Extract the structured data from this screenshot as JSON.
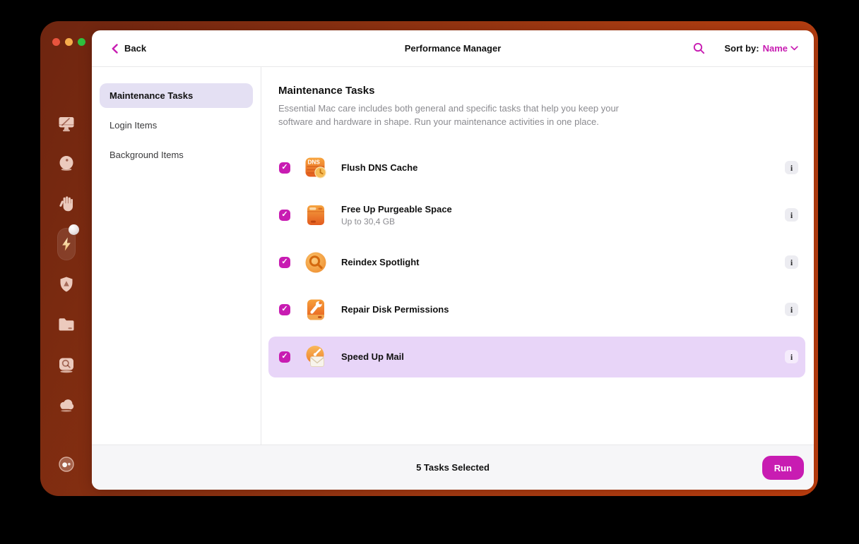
{
  "colors": {
    "accent_magenta": "#c81cb2",
    "highlight_row": "#e8d5f8",
    "selected_pill": "#e4e0f3",
    "frame_gradient_start": "#6e2510",
    "frame_gradient_end": "#c2400f",
    "traffic_red": "#e8543e",
    "traffic_yellow": "#f6ad4c",
    "traffic_green": "#2fc33f"
  },
  "header": {
    "back": "Back",
    "title": "Performance Manager",
    "sort_label": "Sort by:",
    "sort_value": "Name"
  },
  "sidebar": {
    "items": [
      {
        "label": "Maintenance Tasks",
        "selected": true
      },
      {
        "label": "Login Items",
        "selected": false
      },
      {
        "label": "Background Items",
        "selected": false
      }
    ]
  },
  "content": {
    "heading": "Maintenance Tasks",
    "description": "Essential Mac care includes both general and specific tasks that help you keep your software and hardware in shape. Run your maintenance activities in one place.",
    "tasks": [
      {
        "label": "Flush DNS Cache",
        "icon": "dns-clock-icon",
        "icon_text": "DNS",
        "checked": true,
        "highlighted": false
      },
      {
        "label": "Free Up Purgeable Space",
        "subtitle": "Up to 30,4 GB",
        "icon": "hard-drive-icon",
        "checked": true,
        "highlighted": false
      },
      {
        "label": "Reindex Spotlight",
        "icon": "magnifier-badge-icon",
        "checked": true,
        "highlighted": false
      },
      {
        "label": "Repair Disk Permissions",
        "icon": "wrench-drive-icon",
        "checked": true,
        "highlighted": false
      },
      {
        "label": "Speed Up Mail",
        "icon": "mail-gauge-icon",
        "checked": true,
        "highlighted": true
      }
    ]
  },
  "footer": {
    "status": "5 Tasks Selected",
    "run": "Run"
  },
  "rail": {
    "icons": [
      "display-icon",
      "sphere-icon",
      "hand-icon",
      "lightning-icon",
      "shield-icon",
      "folder-icon",
      "disk-search-icon",
      "cloud-icon",
      "assistant-icon"
    ],
    "active": "lightning-icon"
  },
  "icons": {
    "check": "✓",
    "info": "i"
  }
}
